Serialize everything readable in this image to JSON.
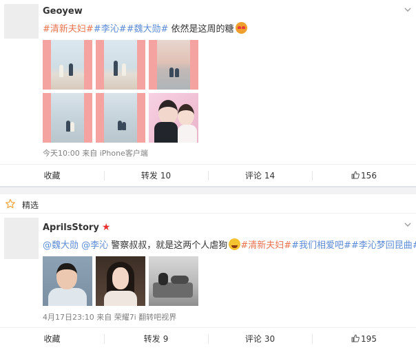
{
  "posts": [
    {
      "username": "Geoyew",
      "content": {
        "tag1": "#清新夫妇#",
        "tag2": "#李沁#",
        "tag3": "#魏大勋#",
        "text": " 依然是这周的糖"
      },
      "emoji": "heart-eyes-emoji",
      "meta": "今天10:00 来自 iPhone客户端",
      "actions": {
        "favorite": "收藏",
        "repost_label": "转发",
        "repost_count": "10",
        "comment_label": "评论",
        "comment_count": "14",
        "like_count": "156"
      }
    },
    {
      "username": "AprilsStory",
      "verified_icon": "star-badge-icon",
      "content": {
        "mention1": "@魏大勋",
        "mention2": "@李沁",
        "text": " 警察叔叔，就是这两个人虐狗",
        "tag1": "#清新夫妇#",
        "tag2": "#我们相爱吧#",
        "tag3": "#李沁梦回昆曲#"
      },
      "emoji": "laughing-emoji",
      "meta": "4月17日23:10 来自 荣耀7i 翻转吧视界",
      "actions": {
        "favorite": "收藏",
        "repost_label": "转发",
        "repost_count": "9",
        "comment_label": "评论",
        "comment_count": "30",
        "like_count": "195"
      }
    }
  ],
  "featured": {
    "label": "精选",
    "icon": "star-outline-icon"
  },
  "colors": {
    "tag_red": "#eb7350",
    "link_blue": "#5c8bd6",
    "meta_gray": "#808080",
    "star_orange": "#f3a33a"
  }
}
